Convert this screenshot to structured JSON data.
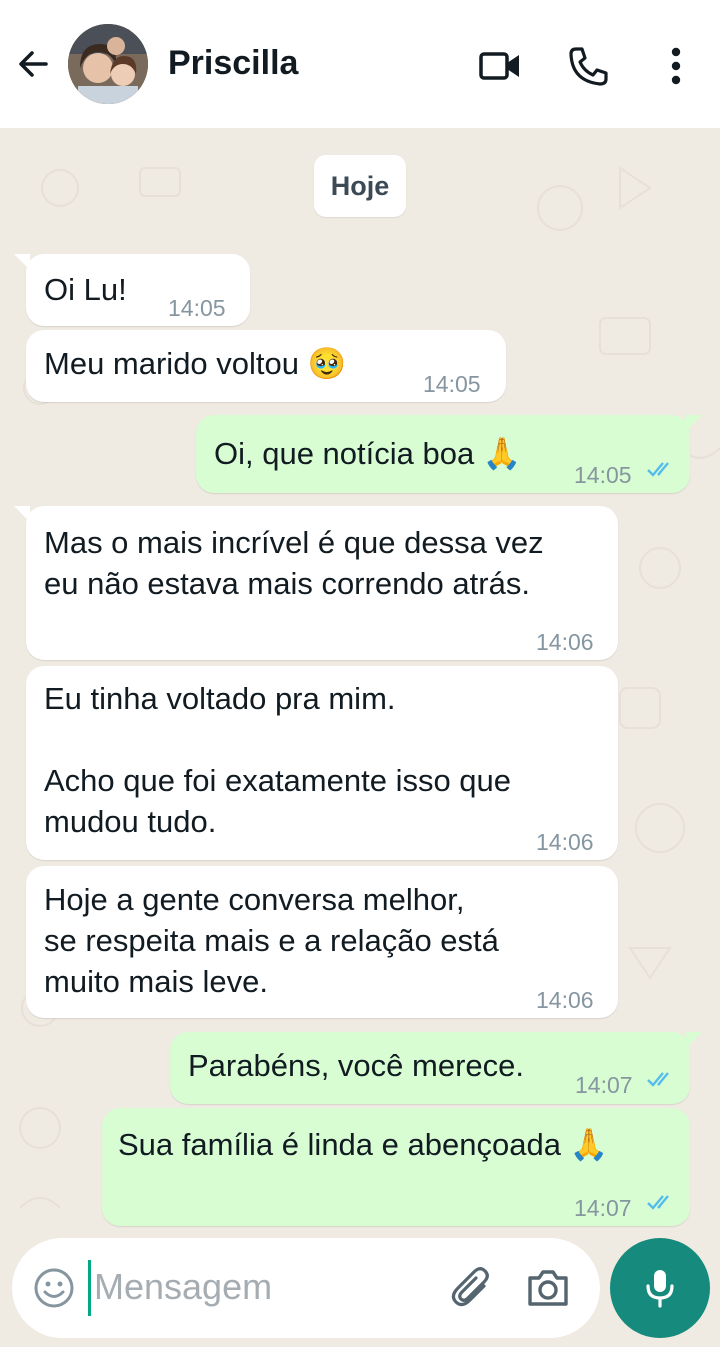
{
  "header": {
    "contact_name": "Priscilla"
  },
  "date_chip": "Hoje",
  "messages": [
    {
      "dir": "in",
      "text": "Oi Lu!",
      "time": "14:05"
    },
    {
      "dir": "in",
      "text": "Meu marido voltou 🥹",
      "time": "14:05"
    },
    {
      "dir": "out",
      "text": "Oi, que notícia boa 🙏",
      "time": "14:05",
      "status": "read"
    },
    {
      "dir": "in",
      "text": "Mas o mais incrível é que dessa vez\neu não estava mais correndo atrás.",
      "time": "14:06"
    },
    {
      "dir": "in",
      "text": "Eu tinha voltado pra mim.\n\nAcho que foi exatamente isso que\nmudou tudo.",
      "time": "14:06"
    },
    {
      "dir": "in",
      "text": "Hoje a gente conversa melhor,\nse respeita mais e a relação está\nmuito mais leve.",
      "time": "14:06"
    },
    {
      "dir": "out",
      "text": "Parabéns, você merece.",
      "time": "14:07",
      "status": "read"
    },
    {
      "dir": "out",
      "text": "Sua família é linda e abençoada 🙏",
      "time": "14:07",
      "status": "read"
    }
  ],
  "composer": {
    "placeholder": "Mensagem"
  },
  "icons": {
    "back": "arrow-left-icon",
    "video": "video-camera-icon",
    "call": "phone-icon",
    "menu": "more-vertical-icon",
    "emoji": "smiley-icon",
    "attach": "paperclip-icon",
    "camera": "camera-icon",
    "mic": "microphone-icon"
  },
  "colors": {
    "chat_background": "#efeae2",
    "incoming_bubble": "#ffffff",
    "outgoing_bubble": "#d9fdd3",
    "read_ticks": "#53bdeb",
    "accent": "#168a7d"
  }
}
